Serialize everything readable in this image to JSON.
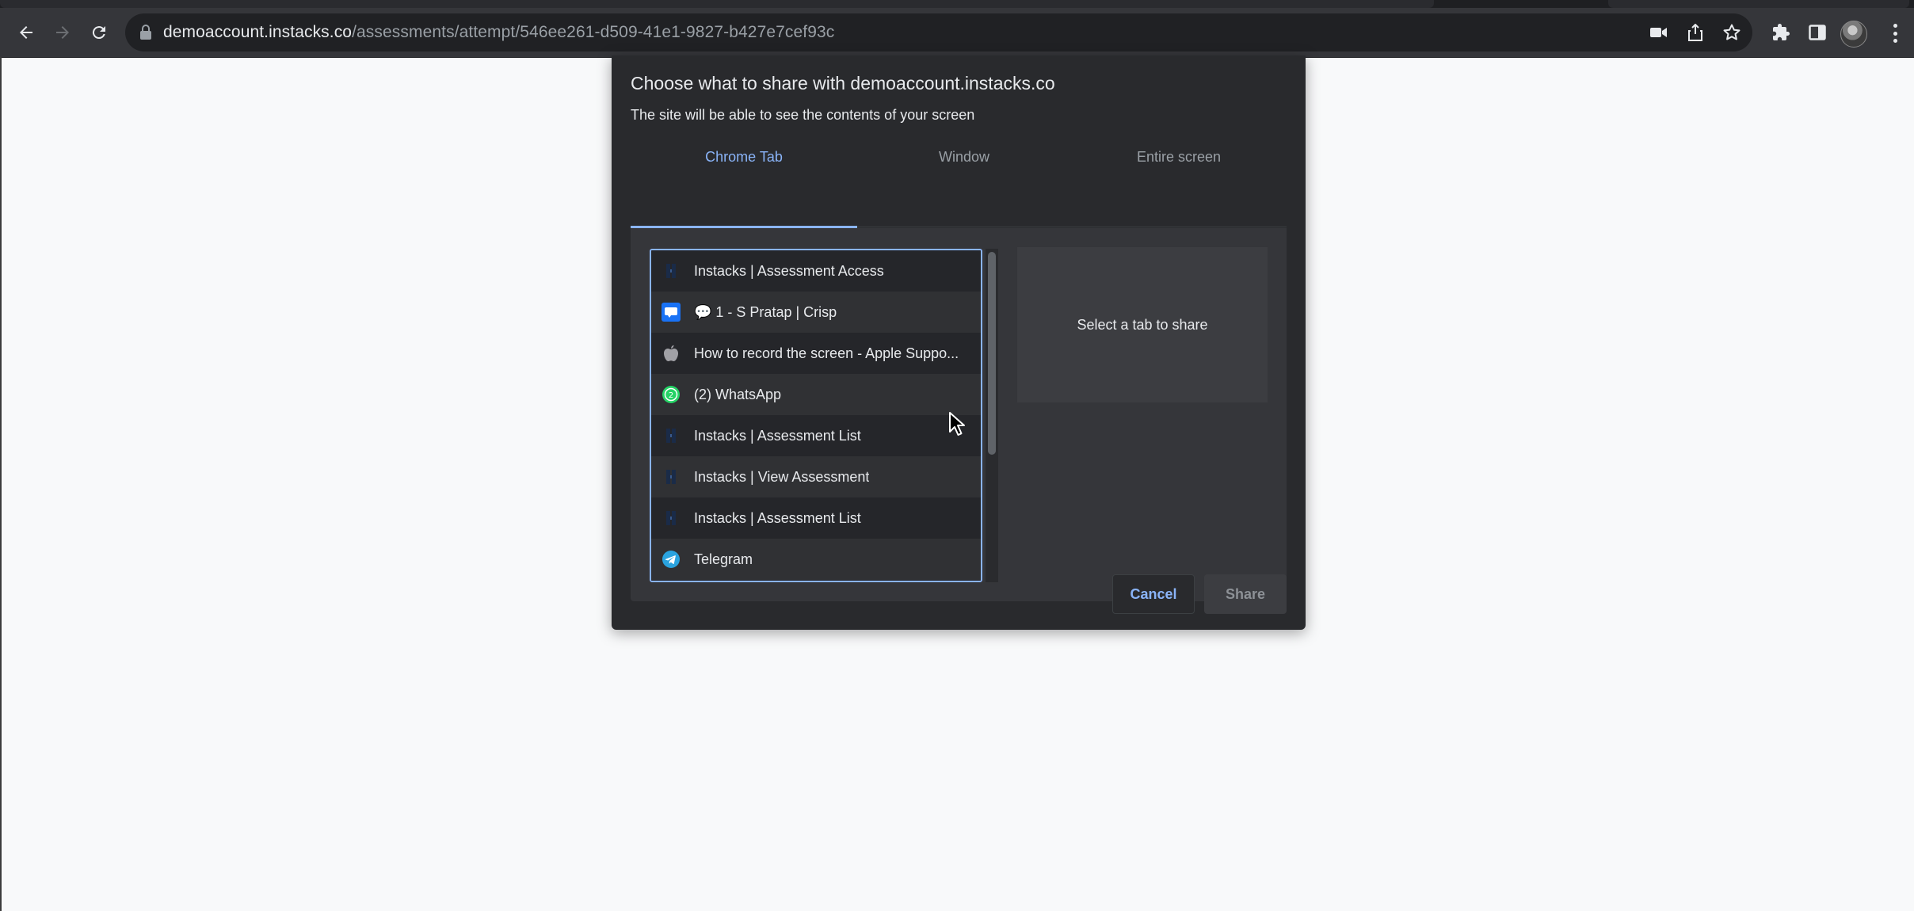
{
  "browser": {
    "url_host": "demoaccount.instacks.co",
    "url_path": "/assessments/attempt/546ee261-d509-41e1-9827-b427e7cef93c",
    "nav": {
      "back": "back-arrow-icon",
      "forward": "forward-arrow-icon",
      "reload": "reload-icon"
    },
    "icons": [
      "camera-icon",
      "share-icon",
      "star-icon",
      "extensions-icon",
      "side-panel-icon",
      "avatar",
      "menu-icon"
    ]
  },
  "dialog": {
    "title": "Choose what to share with demoaccount.instacks.co",
    "subtitle": "The site will be able to see the contents of your screen",
    "tabs": [
      {
        "label": "Chrome Tab",
        "active": true
      },
      {
        "label": "Window",
        "active": false
      },
      {
        "label": "Entire screen",
        "active": false
      }
    ],
    "tab_list": [
      {
        "title": "Instacks | Assessment Access",
        "favicon": "instacks"
      },
      {
        "title": "💬 1 - S Pratap | Crisp",
        "favicon": "crisp"
      },
      {
        "title": "How to record the screen - Apple Suppo...",
        "favicon": "apple"
      },
      {
        "title": "(2) WhatsApp",
        "favicon": "whatsapp"
      },
      {
        "title": "Instacks | Assessment List",
        "favicon": "instacks"
      },
      {
        "title": "Instacks | View Assessment",
        "favicon": "instacks"
      },
      {
        "title": "Instacks | Assessment List",
        "favicon": "instacks"
      },
      {
        "title": "Telegram",
        "favicon": "telegram"
      },
      {
        "title": "",
        "favicon": "instacks"
      }
    ],
    "preview_text": "Select a tab to share",
    "buttons": {
      "cancel": "Cancel",
      "share": "Share"
    }
  },
  "colors": {
    "accent": "#8ab4f8",
    "dialog_bg": "#292a2d",
    "page_bg": "#f8f9fa"
  }
}
